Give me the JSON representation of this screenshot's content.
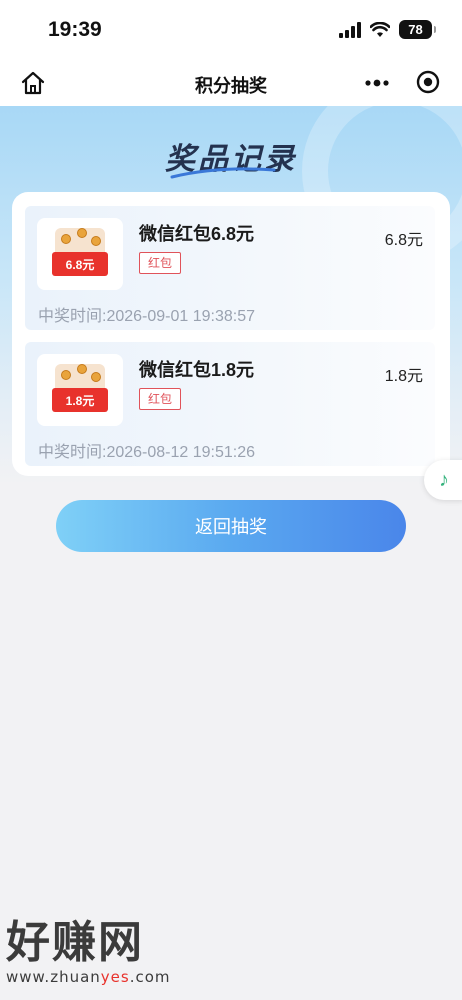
{
  "status_bar": {
    "time": "19:39",
    "battery": "78"
  },
  "nav": {
    "title": "积分抽奖"
  },
  "header": {
    "title": "奖品记录"
  },
  "prizes": [
    {
      "thumb_label": "6.8元",
      "name": "微信红包6.8元",
      "tag": "红包",
      "amount": "6.8元",
      "time": "中奖时间:2026-09-01 19:38:57"
    },
    {
      "thumb_label": "1.8元",
      "name": "微信红包1.8元",
      "tag": "红包",
      "amount": "1.8元",
      "time": "中奖时间:2026-08-12 19:51:26"
    }
  ],
  "actions": {
    "return_label": "返回抽奖"
  },
  "watermark": {
    "main": "好赚网",
    "sub_before": "www.zhuan",
    "sub_highlight": "yes",
    "sub_after": ".com"
  },
  "colors": {
    "accent_red": "#e8322c",
    "button_start": "#7fd0f7",
    "button_end": "#4a86ea",
    "tag_red": "#e0535a"
  },
  "icons": {
    "home": "home-icon",
    "more": "more-dots-icon",
    "record": "record-circle-icon",
    "music": "music-note-icon"
  }
}
